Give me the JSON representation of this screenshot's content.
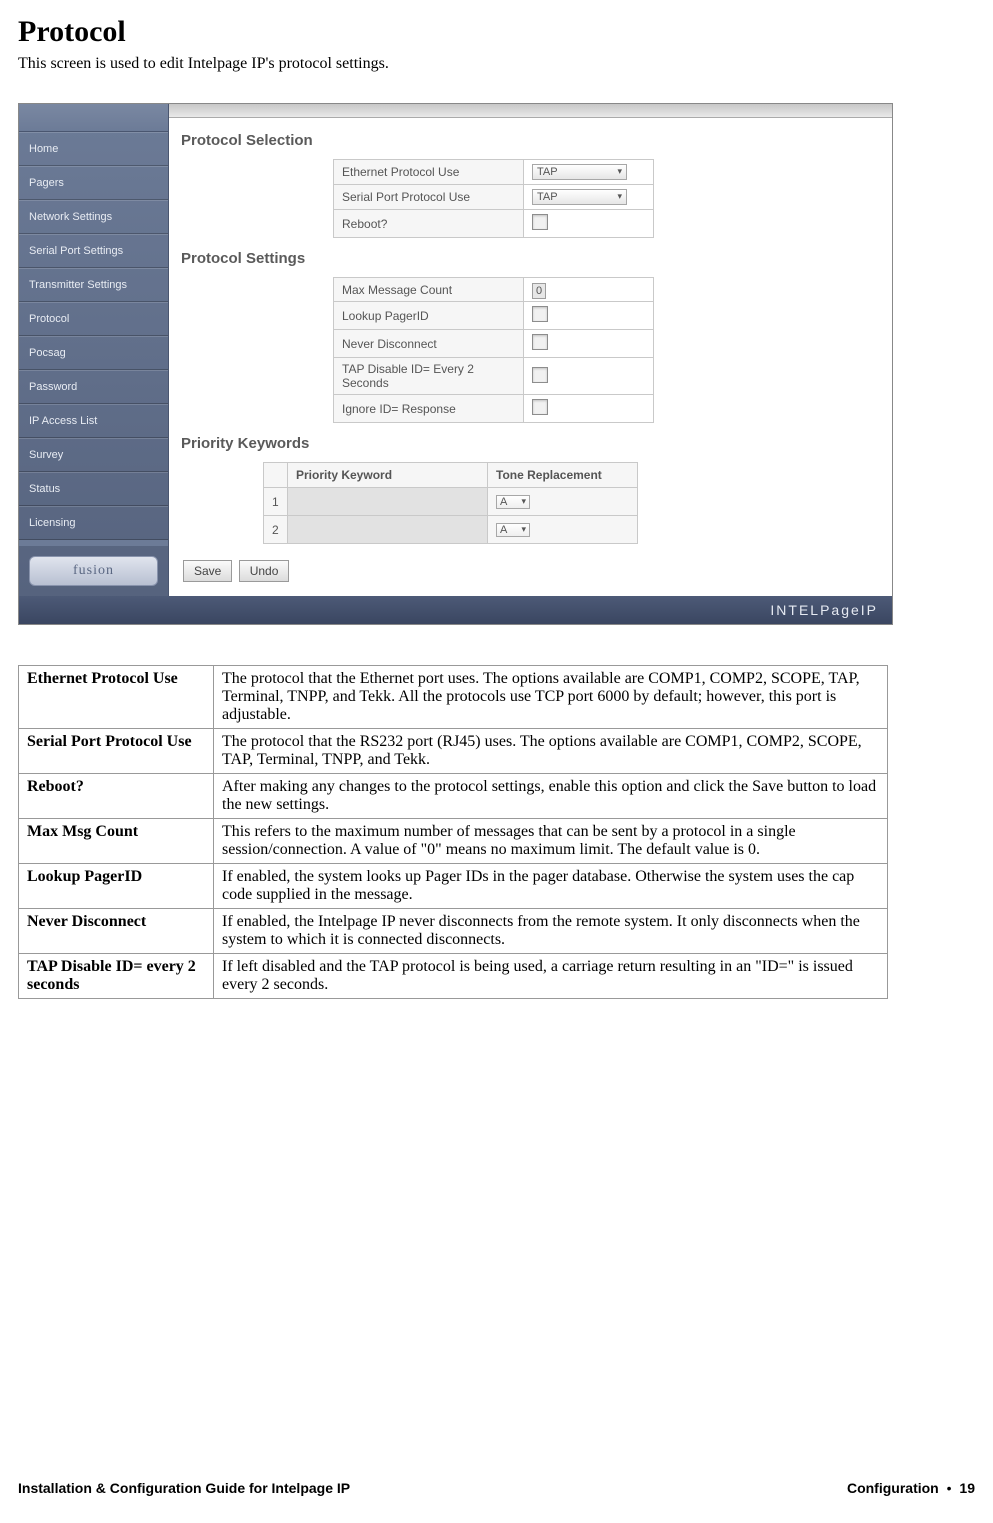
{
  "page": {
    "heading": "Protocol",
    "intro": "This screen is used to edit Intelpage IP's protocol settings."
  },
  "sidebar": {
    "items": [
      "Home",
      "Pagers",
      "Network Settings",
      "Serial Port Settings",
      "Transmitter Settings",
      "Protocol",
      "Pocsag",
      "Password",
      "IP Access List",
      "Survey",
      "Status",
      "Licensing"
    ],
    "logo": "fusion"
  },
  "sections": {
    "protocol_selection": {
      "title": "Protocol Selection",
      "rows": [
        {
          "label": "Ethernet Protocol Use",
          "type": "select",
          "value": "TAP"
        },
        {
          "label": "Serial Port Protocol Use",
          "type": "select",
          "value": "TAP"
        },
        {
          "label": "Reboot?",
          "type": "checkbox"
        }
      ]
    },
    "protocol_settings": {
      "title": "Protocol Settings",
      "rows": [
        {
          "label": "Max Message Count",
          "type": "number",
          "value": "0"
        },
        {
          "label": "Lookup PagerID",
          "type": "checkbox"
        },
        {
          "label": "Never Disconnect",
          "type": "checkbox"
        },
        {
          "label": "TAP Disable ID= Every 2 Seconds",
          "type": "checkbox"
        },
        {
          "label": "Ignore ID= Response",
          "type": "checkbox"
        }
      ]
    },
    "priority_keywords": {
      "title": "Priority Keywords",
      "headers": {
        "kw": "Priority Keyword",
        "tr": "Tone Replacement"
      },
      "rows": [
        {
          "num": "1",
          "tone": "A"
        },
        {
          "num": "2",
          "tone": "A"
        }
      ]
    }
  },
  "buttons": {
    "save": "Save",
    "undo": "Undo"
  },
  "brand": "INTELPageIP",
  "descTable": [
    {
      "key": "Ethernet Protocol Use",
      "val": "The protocol that the Ethernet port uses. The options available are COMP1, COMP2, SCOPE, TAP, Terminal, TNPP, and Tekk. All the protocols use TCP port 6000 by default; however, this port is adjustable."
    },
    {
      "key": "Serial Port Protocol Use",
      "val": "The protocol that the RS232 port (RJ45) uses. The options available are COMP1, COMP2, SCOPE, TAP, Terminal, TNPP, and Tekk."
    },
    {
      "key": "Reboot?",
      "val": "After making any changes to the protocol settings, enable this option and click the Save button to load the new settings."
    },
    {
      "key": "Max Msg Count",
      "val": "This refers to the maximum number of messages that can be sent by a protocol in a single session/connection. A value of \"0\" means no maximum limit. The default value is 0."
    },
    {
      "key": "Lookup PagerID",
      "val": "If enabled, the system looks up Pager IDs in the pager database. Otherwise the system uses the cap code supplied in the message."
    },
    {
      "key": "Never Disconnect",
      "val": "If enabled, the Intelpage IP never disconnects from the remote system. It only disconnects when the system to which it is connected disconnects."
    },
    {
      "key": "TAP Disable ID= every 2 seconds",
      "val": "If left disabled and the TAP protocol is being used, a carriage return resulting in an \"ID=\" is issued every 2 seconds."
    }
  ],
  "footer": {
    "left": "Installation & Configuration Guide for Intelpage IP",
    "right_section": "Configuration",
    "right_page": "19"
  }
}
